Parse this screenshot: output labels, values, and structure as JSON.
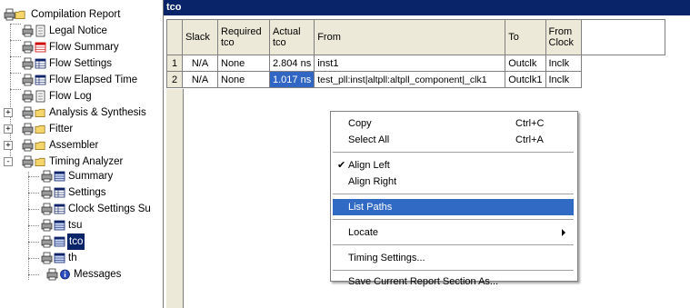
{
  "tree": {
    "root": "Compilation Report",
    "items": [
      {
        "label": "Legal Notice"
      },
      {
        "label": "Flow Summary"
      },
      {
        "label": "Flow Settings"
      },
      {
        "label": "Flow Elapsed Time"
      },
      {
        "label": "Flow Log"
      },
      {
        "label": "Analysis & Synthesis"
      },
      {
        "label": "Fitter"
      },
      {
        "label": "Assembler"
      },
      {
        "label": "Timing Analyzer"
      },
      {
        "label": "Summary"
      },
      {
        "label": "Settings"
      },
      {
        "label": "Clock Settings Su"
      },
      {
        "label": "tsu"
      },
      {
        "label": "tco"
      },
      {
        "label": "th"
      },
      {
        "label": "Messages"
      }
    ],
    "toggle_expand": "+",
    "toggle_collapse": "-"
  },
  "report": {
    "title": "tco",
    "columns": [
      "Slack",
      "Required tco",
      "Actual tco",
      "From",
      "To",
      "From Clock"
    ],
    "rows": [
      {
        "num": "1",
        "slack": "N/A",
        "required": "None",
        "actual": "2.804 ns",
        "from": "inst1",
        "to": "Outclk",
        "from_clock": "Inclk"
      },
      {
        "num": "2",
        "slack": "N/A",
        "required": "None",
        "actual": "1.017 ns",
        "from": "test_pll:inst|altpll:altpll_component|_clk1",
        "to": "Outclk1",
        "from_clock": "Inclk"
      }
    ]
  },
  "context_menu": {
    "copy": "Copy",
    "copy_shortcut": "Ctrl+C",
    "select_all": "Select All",
    "select_all_shortcut": "Ctrl+A",
    "align_left": "Align Left",
    "align_right": "Align Right",
    "list_paths": "List Paths",
    "locate": "Locate",
    "timing_settings": "Timing Settings...",
    "save_section": "Save Current Report Section As...",
    "check_mark": "✔"
  },
  "colors": {
    "header_bar": "#0a246a",
    "selection": "#3166c5",
    "menu_highlight": "#316ac5"
  }
}
